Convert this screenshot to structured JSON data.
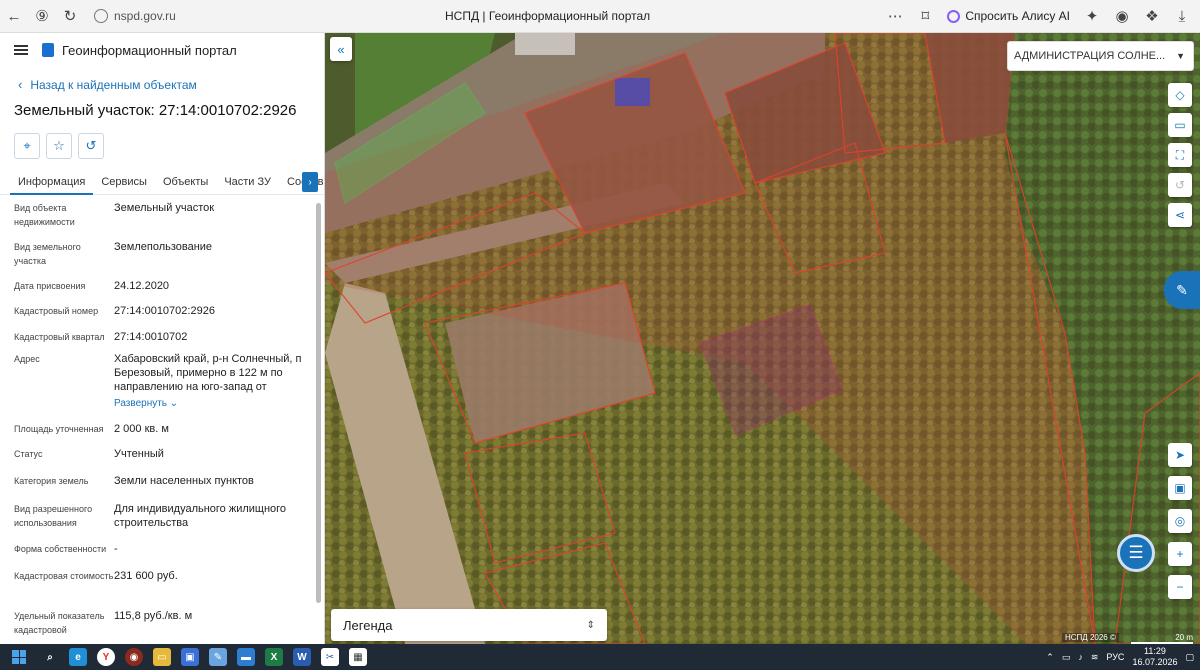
{
  "browser": {
    "url": "nspd.gov.ru",
    "page_title": "НСПД | Геоинформационный портал",
    "alice_label": "Спросить Алису AI",
    "icons": [
      "back-icon",
      "yandex-icon",
      "reload-icon",
      "more-icon",
      "bookmark-icon",
      "ai-icon",
      "extension-icon",
      "download-icon"
    ]
  },
  "panel": {
    "portal_title": "Геоинформационный портал",
    "back_label": "Назад к найденным объектам",
    "object_title": "Земельный участок: 27:14:0010702:2926",
    "tabs": [
      {
        "label": "Информация"
      },
      {
        "label": "Сервисы"
      },
      {
        "label": "Объекты"
      },
      {
        "label": "Части ЗУ"
      },
      {
        "label": "Состав"
      }
    ],
    "fields": [
      {
        "label": "Вид объекта недвижимости",
        "value": "Земельный участок"
      },
      {
        "label": "Вид земельного участка",
        "value": "Землепользование"
      },
      {
        "label": "Дата присвоения",
        "value": "24.12.2020"
      },
      {
        "label": "Кадастровый номер",
        "value": "27:14:0010702:2926"
      },
      {
        "label": "Кадастровый квартал",
        "value": "27:14:0010702"
      },
      {
        "label": "Адрес",
        "value": "Хабаровский край, р-н Солнечный, п Березовый, примерно в 122 м по направлению на юго-запад от"
      },
      {
        "label": "Площадь уточненная",
        "value": "2 000 кв. м"
      },
      {
        "label": "Статус",
        "value": "Учтенный"
      },
      {
        "label": "Категория земель",
        "value": "Земли населенных пунктов"
      },
      {
        "label": "Вид разрешенного использования",
        "value": "Для индивидуального жилищного строительства"
      },
      {
        "label": "Форма собственности",
        "value": "-"
      },
      {
        "label": "Кадастровая стоимость",
        "value": "231 600 руб."
      },
      {
        "label": "Удельный показатель кадастровой",
        "value": "115,8 руб./кв. м"
      }
    ],
    "expand_label": "Развернуть"
  },
  "map": {
    "admin_select": "АДМИНИСТРАЦИЯ СОЛНЕ...",
    "legend_label": "Легенда",
    "attribution": "НСПД 2026 ©",
    "scale_label": "20 m"
  },
  "taskbar": {
    "lang": "РУС",
    "time": "11:29",
    "date": "16.07.2026"
  }
}
